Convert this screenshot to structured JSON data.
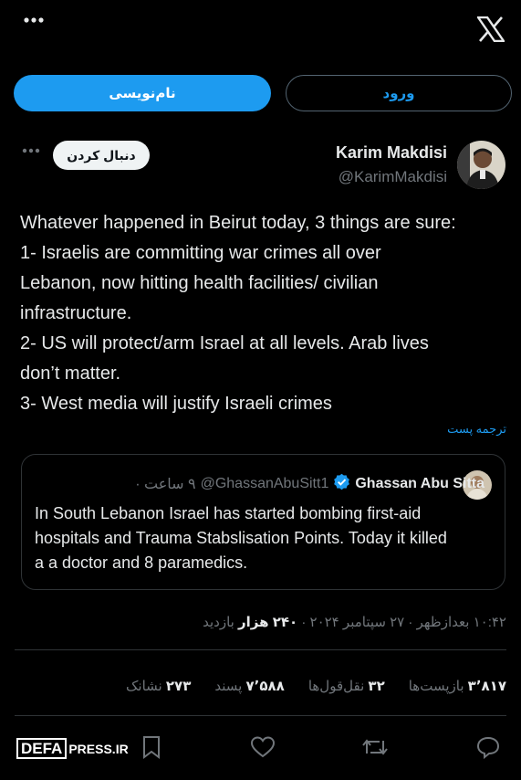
{
  "topbar": {
    "more_icon": "more-horizontal-icon",
    "logo_icon": "x-logo-icon"
  },
  "buttons": {
    "signup_label": "نام‌نویسی",
    "login_label": "ورود"
  },
  "author": {
    "name": "Karim Makdisi",
    "handle": "@KarimMakdisi",
    "follow_label": "دنبال کردن"
  },
  "tweet": {
    "lines": [
      "Whatever happened in Beirut today, 3 things are sure:",
      "1- Israelis are committing war crimes all over",
      "Lebanon, now hitting health facilities/ civilian",
      "infrastructure.",
      "2- US will protect/arm Israel at all levels. Arab lives",
      "don’t matter.",
      "3- West media will justify Israeli crimes"
    ],
    "translate_label": "ترجمه پست"
  },
  "quote": {
    "name": "Ghassan Abu Sitta",
    "handle": "@GhassanAbuSitt1",
    "time": "۹ ساعت ·",
    "lines": [
      "In South Lebanon Israel has started bombing first-aid",
      "hospitals and Trauma Stabslisation Points. Today it killed",
      "a a doctor and 8 paramedics."
    ]
  },
  "meta": {
    "time": "۱۰:۴۲ بعدازظهر",
    "date": "۲۷ سپتامبر ۲۰۲۴",
    "views_count": "۲۴۰ هزار",
    "views_label": "بازدید"
  },
  "stats": {
    "reposts_count": "۳٬۸۱۷",
    "reposts_label": "بازپست‌ها",
    "quotes_count": "۳۲",
    "quotes_label": "نقل‌قول‌ها",
    "likes_count": "۷٬۵۸۸",
    "likes_label": "پسند",
    "bookmarks_count": "۲۷۳",
    "bookmarks_label": "نشانک"
  },
  "watermark": {
    "logo": "DEFA",
    "text": "PRESS.IR"
  },
  "colors": {
    "accent": "#1d9bf0",
    "background": "#000000",
    "muted": "#71767b",
    "verified": "#1d9bf0"
  }
}
